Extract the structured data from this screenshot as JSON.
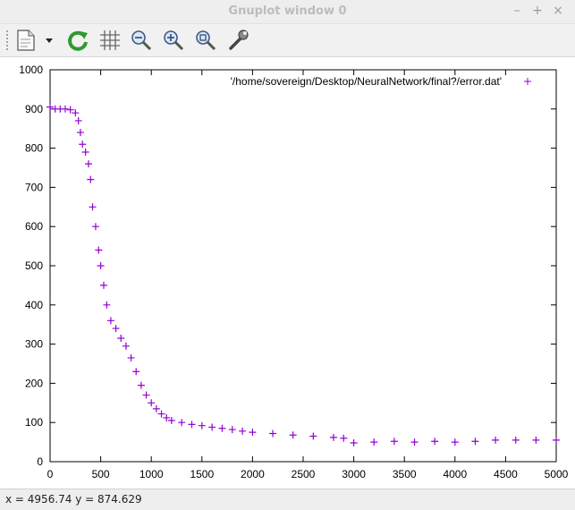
{
  "window": {
    "title": "Gnuplot window 0",
    "controls": {
      "minimize": "–",
      "maximize": "+",
      "close": "×"
    }
  },
  "toolbar": {
    "items": [
      {
        "name": "export",
        "icon": "export-document-icon"
      },
      {
        "name": "export-menu",
        "icon": "chevron-down-icon"
      },
      {
        "name": "replot",
        "icon": "refresh-icon"
      },
      {
        "name": "grid",
        "icon": "grid-icon"
      },
      {
        "name": "zoom-out",
        "icon": "zoom-out-icon"
      },
      {
        "name": "zoom-in",
        "icon": "zoom-in-icon"
      },
      {
        "name": "zoom-fit",
        "icon": "zoom-fit-icon"
      },
      {
        "name": "settings",
        "icon": "wrench-icon"
      }
    ]
  },
  "status": {
    "text": "x = 4956.74 y = 874.629"
  },
  "chart_data": {
    "type": "scatter",
    "title": "",
    "xlabel": "",
    "ylabel": "",
    "xlim": [
      0,
      5000
    ],
    "ylim": [
      0,
      1000
    ],
    "xticks": [
      "0",
      "500",
      "1000",
      "1500",
      "2000",
      "2500",
      "3000",
      "3500",
      "4000",
      "4500",
      "5000"
    ],
    "yticks": [
      "0",
      "100",
      "200",
      "300",
      "400",
      "500",
      "600",
      "700",
      "800",
      "900",
      "1000"
    ],
    "grid": false,
    "legend": {
      "position": "top-right",
      "label": "'/home/sovereign/Desktop/NeuralNetwork/final?/error.dat'"
    },
    "marker": "+",
    "color": "#9400d3",
    "series": [
      {
        "name": "'/home/sovereign/Desktop/NeuralNetwork/final?/error.dat'",
        "x": [
          0,
          50,
          100,
          150,
          200,
          250,
          280,
          300,
          320,
          350,
          380,
          400,
          420,
          450,
          480,
          500,
          530,
          560,
          600,
          650,
          700,
          750,
          800,
          850,
          900,
          950,
          1000,
          1050,
          1100,
          1150,
          1200,
          1300,
          1400,
          1500,
          1600,
          1700,
          1800,
          1900,
          2000,
          2200,
          2400,
          2600,
          2800,
          2900,
          3000,
          3200,
          3400,
          3600,
          3800,
          4000,
          4200,
          4400,
          4600,
          4800,
          5000
        ],
        "y": [
          905,
          900,
          900,
          900,
          898,
          890,
          870,
          840,
          810,
          790,
          760,
          720,
          650,
          600,
          540,
          500,
          450,
          400,
          360,
          340,
          315,
          295,
          265,
          230,
          195,
          170,
          150,
          135,
          122,
          112,
          105,
          100,
          95,
          92,
          88,
          85,
          82,
          78,
          75,
          72,
          68,
          65,
          62,
          60,
          48,
          50,
          52,
          50,
          52,
          50,
          52,
          55,
          55,
          55,
          55
        ]
      }
    ]
  }
}
